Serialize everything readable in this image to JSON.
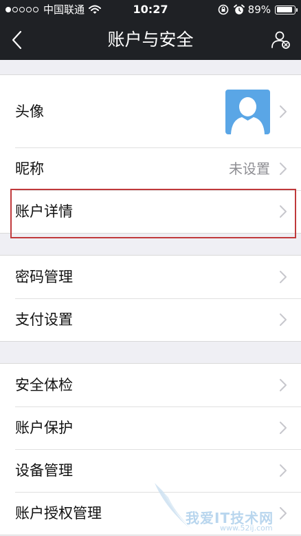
{
  "status_bar": {
    "signal_dots": [
      true,
      false,
      false,
      false,
      false
    ],
    "carrier": "中国联通",
    "time": "10:27",
    "battery_percent_label": "89%",
    "battery_level": 0.89,
    "icons": [
      "wifi-icon",
      "rotation-lock-icon",
      "alarm-icon",
      "battery-icon"
    ]
  },
  "nav": {
    "title": "账户与安全",
    "back_icon": "chevron-left-icon",
    "right_icon": "user-switch-icon"
  },
  "groups": [
    {
      "items": [
        {
          "label": "头像",
          "value": "",
          "kind": "avatar",
          "avatar_icon": "default-avatar-icon",
          "avatar_color": "#5aa6e6"
        },
        {
          "label": "昵称",
          "value": "未设置"
        },
        {
          "label": "账户详情",
          "value": "",
          "highlighted": true
        }
      ]
    },
    {
      "items": [
        {
          "label": "密码管理",
          "value": ""
        },
        {
          "label": "支付设置",
          "value": ""
        }
      ]
    },
    {
      "items": [
        {
          "label": "安全体检",
          "value": ""
        },
        {
          "label": "账户保护",
          "value": ""
        },
        {
          "label": "设备管理",
          "value": ""
        },
        {
          "label": "账户授权管理",
          "value": ""
        }
      ]
    }
  ],
  "watermark": {
    "text": "我爱IT技术网",
    "url": "www.52ij.com"
  },
  "colors": {
    "nav_background": "#1f2125",
    "page_background": "#efeff4",
    "highlight_border": "#c0393b",
    "secondary_text": "#8e8e93"
  }
}
